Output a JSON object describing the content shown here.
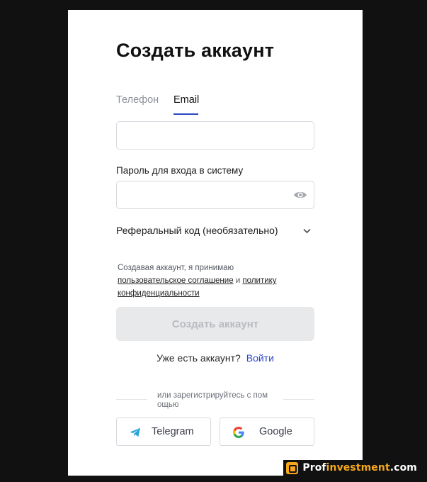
{
  "form": {
    "title": "Создать аккаунт",
    "tabs": [
      {
        "label": "Телефон",
        "active": false
      },
      {
        "label": "Email",
        "active": true
      }
    ],
    "email_value": "",
    "password_label": "Пароль для входа в систему",
    "password_value": "",
    "password_toggle_icon": "eye-icon",
    "referral_label": "Реферальный код (необязательно)",
    "referral_icon": "chevron-down-icon",
    "terms_prefix": "Создавая аккаунт, я принимаю",
    "terms_link_agreement": "пользовательское соглашение",
    "terms_and": "и",
    "terms_link_policy_1": "политику",
    "terms_link_policy_2": "конфиденциальности",
    "submit_label": "Создать аккаунт",
    "have_account": "Уже есть аккаунт?",
    "login_link": "Войти",
    "divider_text": "или зарегистрируйтесь с помощью",
    "social": [
      {
        "label": "Telegram",
        "icon": "telegram-icon"
      },
      {
        "label": "Google",
        "icon": "google-icon"
      }
    ]
  },
  "watermark": {
    "part1": "Prof",
    "part2": "investment",
    "part3": ".com"
  },
  "colors": {
    "accent": "#2b48c4",
    "disabled_button_bg": "#e8e9eb",
    "watermark_accent": "#f5a81c"
  }
}
